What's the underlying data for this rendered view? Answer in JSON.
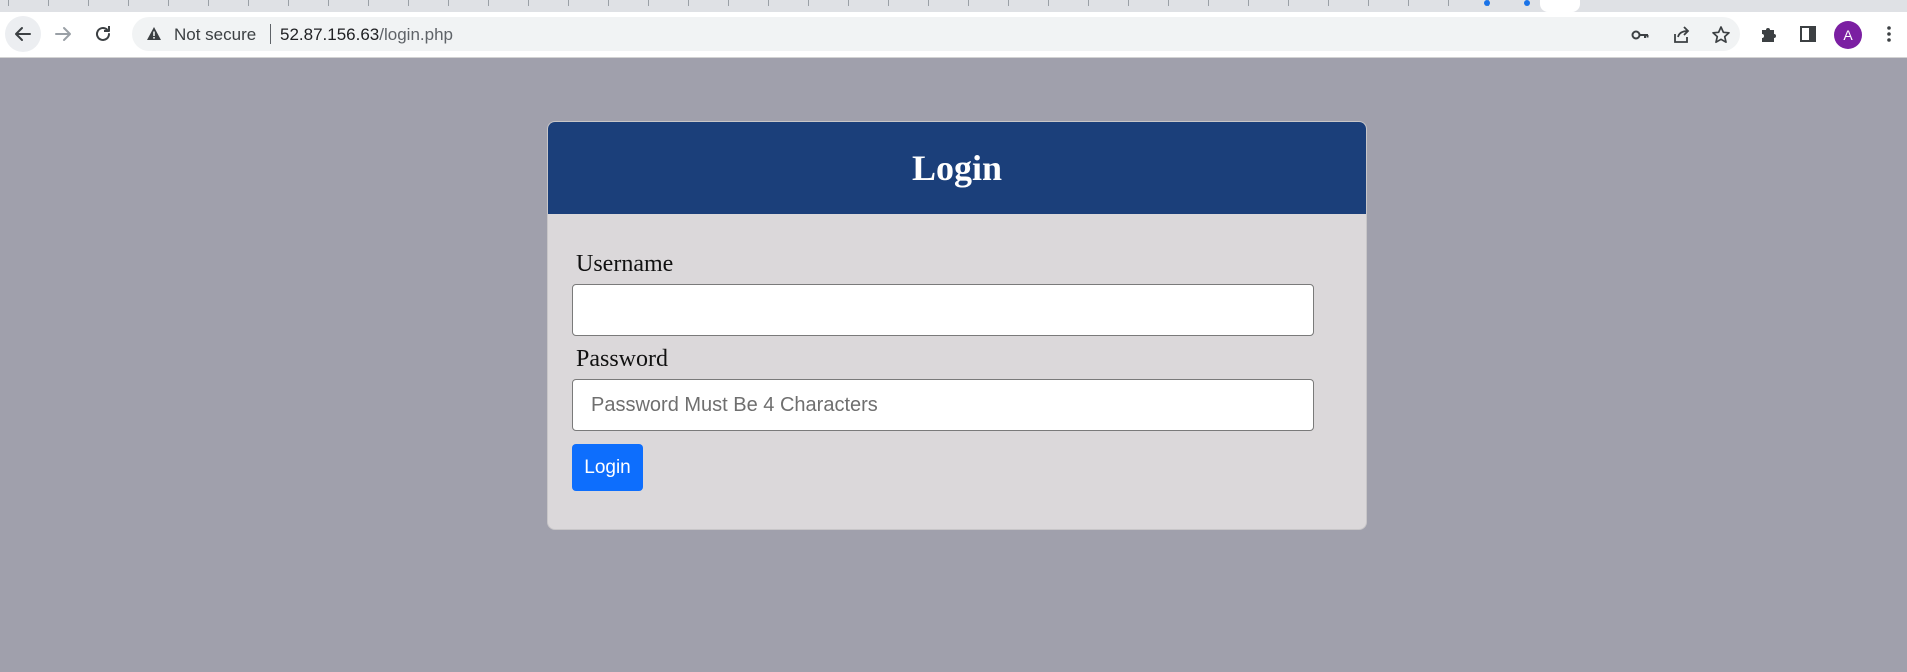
{
  "browser": {
    "security_label": "Not secure",
    "url_host": "52.87.156.63",
    "url_path": "/login.php",
    "profile_initial": "A",
    "profile_color": "#7b1fa2",
    "icons": [
      "back-arrow-icon",
      "forward-arrow-icon",
      "reload-icon",
      "warning-icon",
      "key-icon",
      "share-icon",
      "star-icon",
      "puzzle-icon",
      "side-panel-icon",
      "kebab-menu-icon"
    ]
  },
  "page": {
    "background": "#a0a0ac",
    "title": "Login",
    "header_color": "#1b3f7a",
    "username_label": "Username",
    "username_value": "",
    "password_label": "Password",
    "password_placeholder": "Password Must Be 4 Characters",
    "login_button": "Login",
    "button_color": "#0d6efd"
  }
}
